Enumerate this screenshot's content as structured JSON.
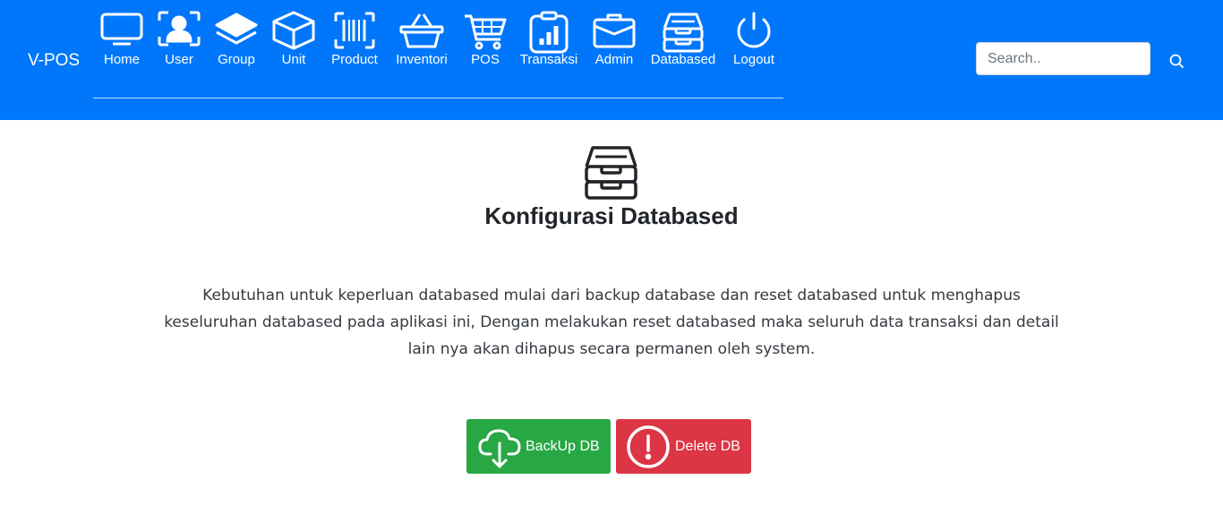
{
  "brand": "V-POS",
  "nav": {
    "items": [
      {
        "label": "Home",
        "icon": "monitor-icon"
      },
      {
        "label": "User",
        "icon": "user-scan-icon"
      },
      {
        "label": "Group",
        "icon": "layers-icon"
      },
      {
        "label": "Unit",
        "icon": "box-icon"
      },
      {
        "label": "Product",
        "icon": "barcode-icon"
      },
      {
        "label": "Inventori",
        "icon": "basket-icon"
      },
      {
        "label": "POS",
        "icon": "cart-icon"
      },
      {
        "label": "Transaksi",
        "icon": "clipboard-chart-icon"
      },
      {
        "label": "Admin",
        "icon": "briefcase-icon"
      },
      {
        "label": "Databased",
        "icon": "inbox-stack-icon"
      },
      {
        "label": "Logout",
        "icon": "power-icon"
      }
    ]
  },
  "search": {
    "placeholder": "Search..",
    "icon": "search-icon"
  },
  "main": {
    "icon": "inbox-stack-icon",
    "title": "Konfigurasi Databased",
    "description": "Kebutuhan untuk keperluan databased mulai dari backup database dan reset databased untuk menghapus keseluruhan databased pada aplikasi ini, Dengan melakukan reset databased maka seluruh data transaksi dan detail lain nya akan dihapus secara permanen oleh system.",
    "buttons": {
      "backup": {
        "label": "BackUp DB",
        "icon": "cloud-download-icon",
        "color": "#28a745"
      },
      "delete": {
        "label": "Delete DB",
        "icon": "exclamation-circle-icon",
        "color": "#dc3545"
      }
    }
  },
  "colors": {
    "navbar": "#0077fb"
  }
}
